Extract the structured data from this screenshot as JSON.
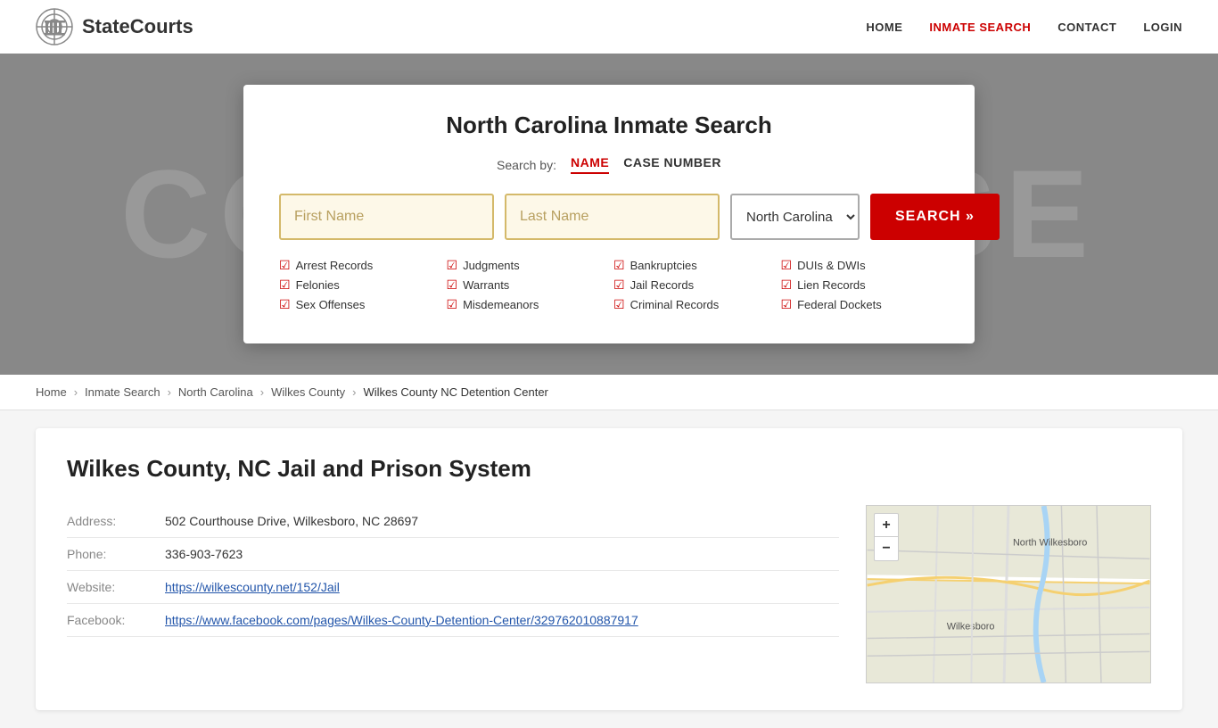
{
  "header": {
    "logo_text": "StateCourts",
    "nav": {
      "home": "HOME",
      "inmate_search": "INMATE SEARCH",
      "contact": "CONTACT",
      "login": "LOGIN"
    }
  },
  "hero": {
    "bg_text": "COURTHOUSE"
  },
  "search_card": {
    "title": "North Carolina Inmate Search",
    "search_by_label": "Search by:",
    "tab_name": "NAME",
    "tab_case": "CASE NUMBER",
    "first_name_placeholder": "First Name",
    "last_name_placeholder": "Last Name",
    "state_value": "North Carolina",
    "search_button": "SEARCH »",
    "checkmarks": [
      "Arrest Records",
      "Judgments",
      "Bankruptcies",
      "DUIs & DWIs",
      "Felonies",
      "Warrants",
      "Jail Records",
      "Lien Records",
      "Sex Offenses",
      "Misdemeanors",
      "Criminal Records",
      "Federal Dockets"
    ]
  },
  "breadcrumb": {
    "items": [
      "Home",
      "Inmate Search",
      "North Carolina",
      "Wilkes County",
      "Wilkes County NC Detention Center"
    ]
  },
  "facility": {
    "title": "Wilkes County, NC Jail and Prison System",
    "address_label": "Address:",
    "address_value": "502 Courthouse Drive, Wilkesboro, NC 28697",
    "phone_label": "Phone:",
    "phone_value": "336-903-7623",
    "website_label": "Website:",
    "website_url": "https://wilkescounty.net/152/Jail",
    "facebook_label": "Facebook:",
    "facebook_url": "https://www.facebook.com/pages/Wilkes-County-Detention-Center/329762010887917"
  },
  "map": {
    "plus": "+",
    "minus": "−",
    "label": "North Wilkesboro",
    "label2": "Wilkesboro"
  }
}
